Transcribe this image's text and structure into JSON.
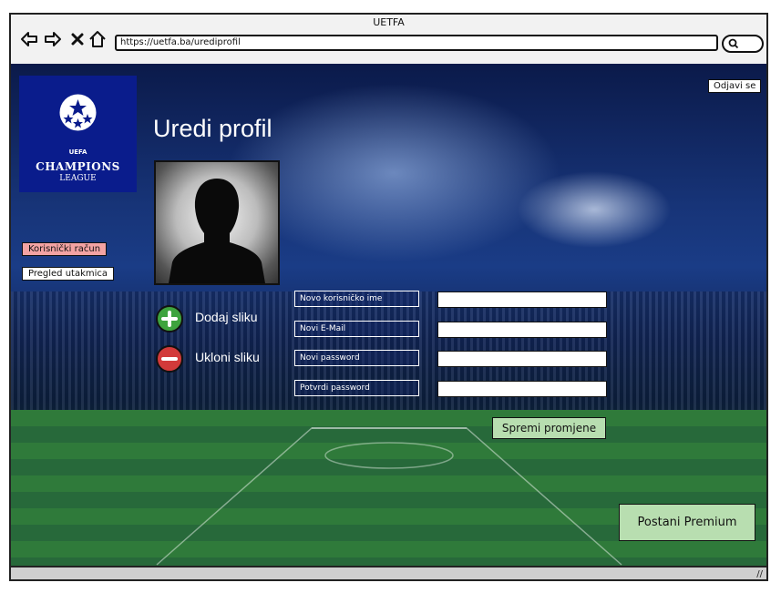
{
  "window": {
    "title": "UETFA"
  },
  "browser": {
    "url": "https://uetfa.ba/urediprofil"
  },
  "logo": {
    "uefa": "UEFA",
    "line1": "CHAMPIONS",
    "line2": "LEAGUE"
  },
  "header": {
    "logout_label": "Odjavi se",
    "page_title": "Uredi profil"
  },
  "sidebar": {
    "items": [
      {
        "label": "Korisnički račun"
      },
      {
        "label": "Pregled utakmica"
      }
    ]
  },
  "photo": {
    "add_label": "Dodaj sliku",
    "remove_label": "Ukloni sliku"
  },
  "form": {
    "fields": [
      {
        "label": "Novo korisničko ime",
        "value": ""
      },
      {
        "label": "Novi E-Mail",
        "value": ""
      },
      {
        "label": "Novi password",
        "value": ""
      },
      {
        "label": "Potvrdi password",
        "value": ""
      }
    ],
    "save_label": "Spremi promjene"
  },
  "premium_label": "Postani Premium",
  "colors": {
    "sidebar_active": "#f3a3a3",
    "button_green": "#b8deb0",
    "logo_blue": "#0a1c8c"
  },
  "icons": [
    "back-arrow-icon",
    "forward-arrow-icon",
    "close-icon",
    "home-icon",
    "search-icon",
    "plus-icon",
    "minus-icon",
    "resize-grip-icon"
  ]
}
